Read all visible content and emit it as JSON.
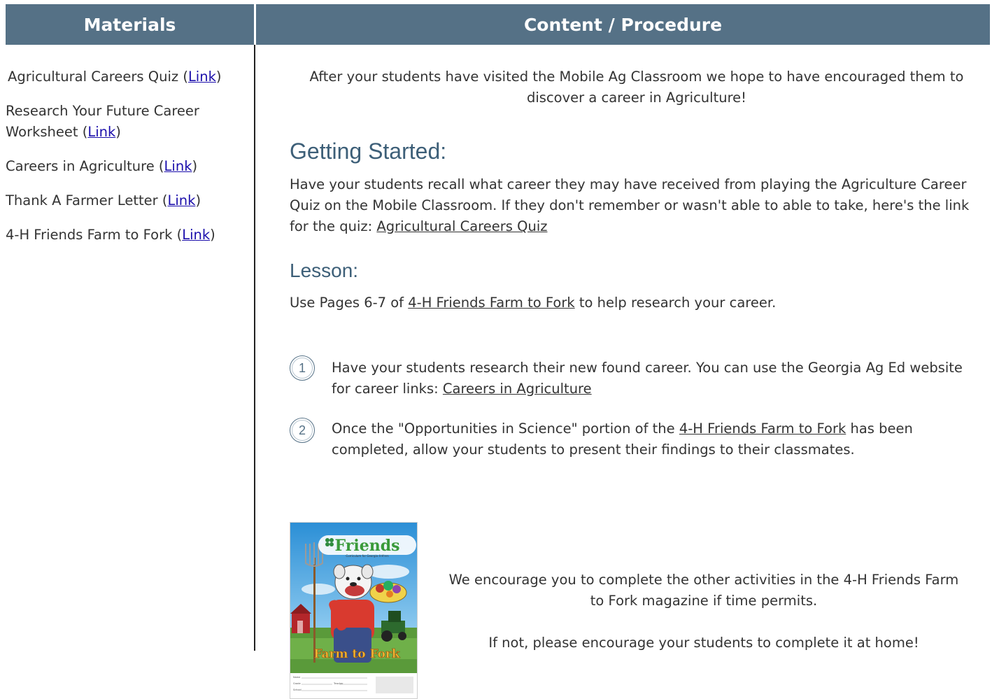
{
  "headers": {
    "materials": "Materials",
    "content": "Content / Procedure"
  },
  "materials": [
    {
      "text": "Agricultural Careers Quiz (",
      "link": "Link",
      "close": ")"
    },
    {
      "text": "Research Your Future Career Worksheet (",
      "link": "Link",
      "close": ")"
    },
    {
      "text": "Careers in Agriculture (",
      "link": "Link",
      "close": ")"
    },
    {
      "text": "Thank A Farmer Letter (",
      "link": "Link",
      "close": ")"
    },
    {
      "text": "4-H Friends Farm to Fork (",
      "link": "Link",
      "close": ")"
    }
  ],
  "intro": "After your students have visited the Mobile Ag Classroom we hope to have encouraged them to discover a career in Agriculture!",
  "getting_started": {
    "heading": "Getting Started:",
    "text": "Have your students recall what career they may have received from playing the Agriculture Career Quiz on the Mobile Classroom. If they don't remember or wasn't able to able to take, here's the link for the quiz: ",
    "link": "Agricultural Careers Quiz"
  },
  "lesson": {
    "heading": "Lesson:",
    "pre": "Use Pages 6-7 of ",
    "link": "4-H Friends Farm to Fork",
    "post": " to help research your career."
  },
  "steps": [
    {
      "num": "1",
      "text": "Have your students research their new found career. You can use the Georgia Ag Ed website for career links: ",
      "link": "Careers in Agriculture ",
      "post": ""
    },
    {
      "num": "2",
      "text": "Once the \"Opportunities in Science\" portion of the ",
      "link": "4-H Friends Farm to Fork",
      "post": " has been completed, allow your students to present their findings to their classmates."
    }
  ],
  "cover": {
    "title": "Friends",
    "subtitle": "Curriculum for Georgia 4-H'ers",
    "banner": "Farm to Fork",
    "form_labels": [
      "Name",
      "Grade",
      "Teacher",
      "School"
    ]
  },
  "closing": {
    "p1": "We encourage you to complete the other activities in the 4-H Friends Farm to Fork magazine if time permits.",
    "p2": "If not, please encourage your students to complete it at home!"
  },
  "colors": {
    "header_bg": "#557186",
    "heading": "#3d5f78",
    "link_blue": "#1a0dab"
  }
}
